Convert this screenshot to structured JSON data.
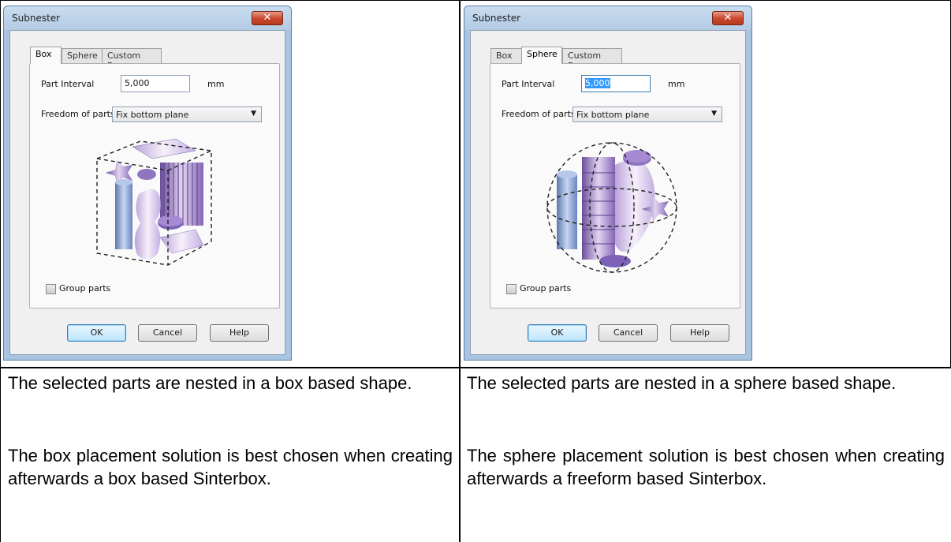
{
  "dialogs": [
    {
      "title": "Subnester",
      "close_glyph": "✕",
      "tabs": [
        "Box",
        "Sphere",
        "Custom Box"
      ],
      "active_tab": "Box",
      "part_interval_label": "Part Interval",
      "part_interval_value": "5,000",
      "part_interval_selected": false,
      "unit": "mm",
      "freedom_label": "Freedom of parts",
      "freedom_value": "Fix bottom plane",
      "illustration_icon": "box-nest-illustration",
      "group_parts_label": "Group parts",
      "group_parts_checked": false,
      "ok_label": "OK",
      "cancel_label": "Cancel",
      "help_label": "Help"
    },
    {
      "title": "Subnester",
      "close_glyph": "✕",
      "tabs": [
        "Box",
        "Sphere",
        "Custom Box"
      ],
      "active_tab": "Sphere",
      "part_interval_label": "Part Interval",
      "part_interval_value": "5,000",
      "part_interval_selected": true,
      "unit": "mm",
      "freedom_label": "Freedom of parts",
      "freedom_value": "Fix bottom plane",
      "illustration_icon": "sphere-nest-illustration",
      "group_parts_label": "Group parts",
      "group_parts_checked": false,
      "ok_label": "OK",
      "cancel_label": "Cancel",
      "help_label": "Help"
    }
  ],
  "descriptions": {
    "left": {
      "p1": "The selected parts are nested in a box based shape.",
      "p2": "The box placement solution is best chosen when creating afterwards a box based Sinterbox."
    },
    "right": {
      "p1": "The selected parts are nested in a sphere based shape.",
      "p2": "The sphere placement solution is best chosen when creating afterwards a freeform based Sinterbox."
    }
  },
  "colors": {
    "dialog_frame": "#a8c4e0",
    "close_button": "#c8452c",
    "selection": "#3399ff",
    "part_purple": "#9a7fc0",
    "part_blue": "#7f9fd0"
  }
}
